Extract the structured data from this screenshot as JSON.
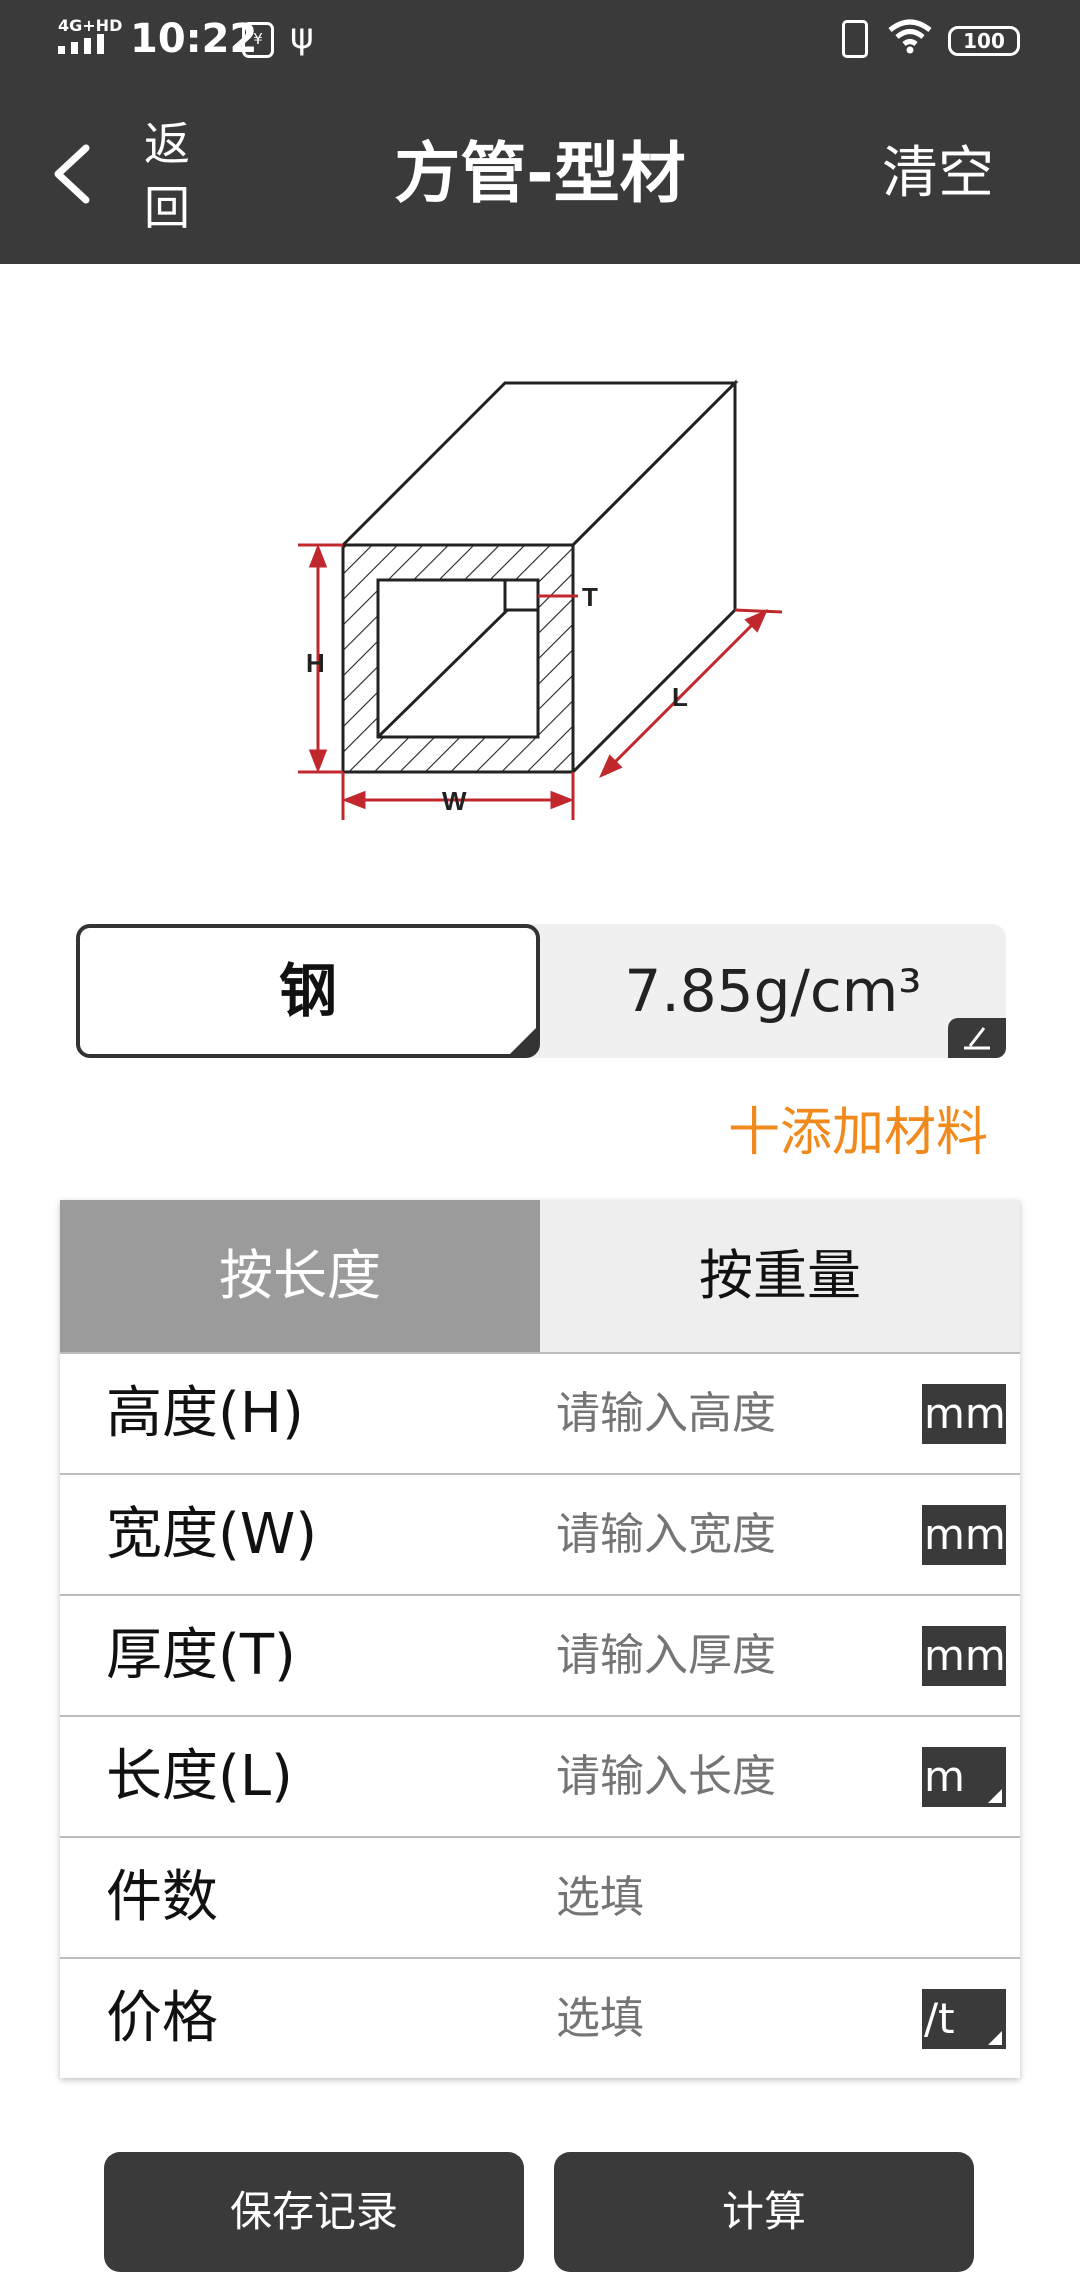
{
  "status_bar": {
    "network": "4G+HD",
    "time": "10:22",
    "battery": "100"
  },
  "app_bar": {
    "back_label": "返回",
    "title": "方管-型材",
    "clear_label": "清空"
  },
  "diagram": {
    "labels": {
      "H": "H",
      "W": "W",
      "T": "T",
      "L": "L"
    }
  },
  "material": {
    "name": "钢",
    "density": "7.85g/cm³",
    "add_label": "十添加材料"
  },
  "tabs": [
    {
      "label": "按长度",
      "active": true
    },
    {
      "label": "按重量",
      "active": false
    }
  ],
  "fields": [
    {
      "label": "高度(H)",
      "placeholder": "请输入高度",
      "unit": "mm",
      "unit_dropdown": false
    },
    {
      "label": "宽度(W)",
      "placeholder": "请输入宽度",
      "unit": "mm",
      "unit_dropdown": false
    },
    {
      "label": "厚度(T)",
      "placeholder": "请输入厚度",
      "unit": "mm",
      "unit_dropdown": false
    },
    {
      "label": "长度(L)",
      "placeholder": "请输入长度",
      "unit": "m",
      "unit_dropdown": true
    },
    {
      "label": "件数",
      "placeholder": "选填",
      "unit": "",
      "unit_dropdown": false
    },
    {
      "label": "价格",
      "placeholder": "选填",
      "unit": "/t",
      "unit_dropdown": true
    }
  ],
  "buttons": {
    "save_label": "保存记录",
    "calc_label": "计算"
  },
  "colors": {
    "dark": "#3a3a3a",
    "accent": "#f08a1c",
    "dimension_red": "#c0282d",
    "tab_active": "#9b9b9b"
  }
}
